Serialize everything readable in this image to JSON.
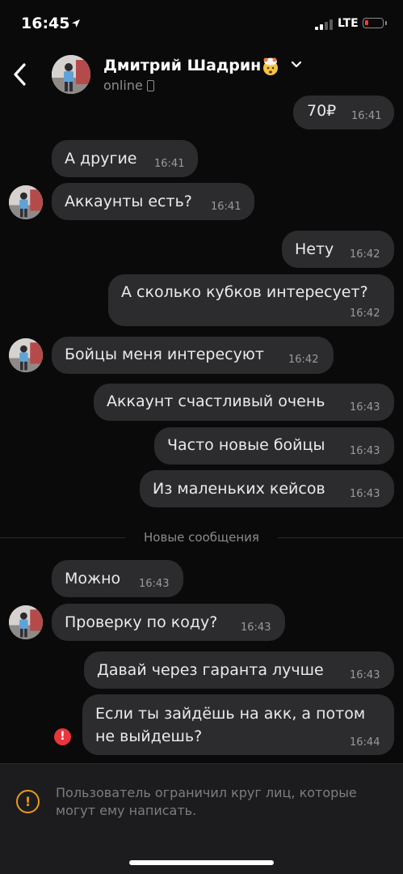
{
  "status_bar": {
    "time": "16:45",
    "network": "LTE",
    "battery_level": 0.1,
    "signal_bars": 2
  },
  "header": {
    "back_icon": "chevron-left-icon",
    "contact_name": "Дмитрий Шадрин",
    "name_emoji": "exploding-head-emoji-icon",
    "presence": "online",
    "presence_device_icon": "phone-icon"
  },
  "messages": [
    {
      "direction": "out",
      "text": "70₽",
      "time": "16:41"
    },
    {
      "direction": "in",
      "text": "А другие",
      "time": "16:41"
    },
    {
      "direction": "in",
      "text": "Аккаунты есть?",
      "time": "16:41",
      "avatar": true
    },
    {
      "direction": "out",
      "text": "Нету",
      "time": "16:42"
    },
    {
      "direction": "out",
      "text": "А сколько кубков интересует?",
      "time": "16:42"
    },
    {
      "direction": "in",
      "text": "Бойцы меня интересуют",
      "time": "16:42",
      "avatar": true
    },
    {
      "direction": "out",
      "text": "Аккаунт счастливый очень",
      "time": "16:43"
    },
    {
      "direction": "out",
      "text": "Часто новые бойцы",
      "time": "16:43"
    },
    {
      "direction": "out",
      "text": "Из маленьких кейсов",
      "time": "16:43"
    },
    {
      "direction": "in",
      "text": "Можно",
      "time": "16:43"
    },
    {
      "direction": "in",
      "text": "Проверку по коду?",
      "time": "16:43",
      "avatar": true
    },
    {
      "direction": "out",
      "text": "Давай через гаранта лучше",
      "time": "16:43"
    },
    {
      "direction": "out",
      "text": "Если ты зайдёшь на акк, а потом",
      "text2": "не выйдешь?",
      "time": "16:44",
      "failed": true
    }
  ],
  "divider": {
    "label": "Новые сообщения"
  },
  "error_icon": "!",
  "notice": {
    "icon": "warning-icon",
    "icon_glyph": "!",
    "text": "Пользователь ограничил круг лиц, которые могут ему написать."
  },
  "colors": {
    "background": "#0a0a0a",
    "bubble": "#2c2c2e",
    "error": "#e8363c",
    "warning": "#e69a1c"
  }
}
